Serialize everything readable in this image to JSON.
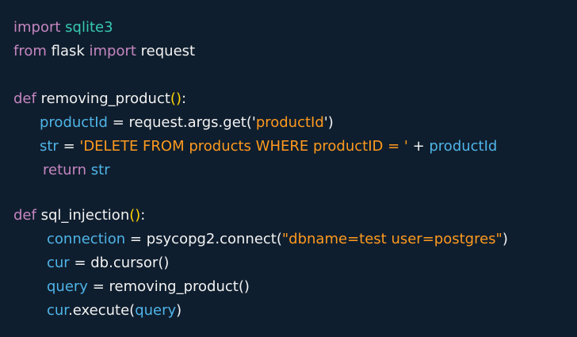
{
  "colors": {
    "background": "#0f1e2e",
    "keyword": "#c586c0",
    "module": "#36c9b3",
    "variable": "#4fb4e8",
    "string": "#ff9a1e",
    "paren": "#ffd400",
    "text": "#f2f2f2"
  },
  "lines": [
    [
      {
        "t": "import",
        "c": "kw"
      },
      {
        "t": " ",
        "c": "plain"
      },
      {
        "t": "sqlite3",
        "c": "mod"
      }
    ],
    [
      {
        "t": "from",
        "c": "kw"
      },
      {
        "t": " flask ",
        "c": "plain"
      },
      {
        "t": "import",
        "c": "kw"
      },
      {
        "t": " request",
        "c": "plain"
      }
    ],
    [],
    [
      {
        "t": "def",
        "c": "kw"
      },
      {
        "t": " removing_product",
        "c": "plain"
      },
      {
        "t": "()",
        "c": "paren"
      },
      {
        "t": ":",
        "c": "plain"
      }
    ],
    [
      {
        "t": "productId",
        "c": "var"
      },
      {
        "t": " = request.args.get('",
        "c": "plain"
      },
      {
        "t": "productId",
        "c": "str"
      },
      {
        "t": "')",
        "c": "plain"
      }
    ],
    [
      {
        "t": "str",
        "c": "var"
      },
      {
        "t": " = ",
        "c": "plain"
      },
      {
        "t": "'DELETE FROM products WHERE productID = '",
        "c": "str"
      },
      {
        "t": " + ",
        "c": "plain"
      },
      {
        "t": "productId",
        "c": "var"
      }
    ],
    [
      {
        "t": "return",
        "c": "kw"
      },
      {
        "t": " ",
        "c": "plain"
      },
      {
        "t": "str",
        "c": "var"
      }
    ],
    [],
    [
      {
        "t": "def",
        "c": "kw"
      },
      {
        "t": " sql_injection",
        "c": "plain"
      },
      {
        "t": "()",
        "c": "paren"
      },
      {
        "t": ":",
        "c": "plain"
      }
    ],
    [
      {
        "t": "connection",
        "c": "var"
      },
      {
        "t": " = psycopg2.connect(",
        "c": "plain"
      },
      {
        "t": "\"dbname=test user=postgres\"",
        "c": "str"
      },
      {
        "t": ")",
        "c": "plain"
      }
    ],
    [
      {
        "t": "cur",
        "c": "var"
      },
      {
        "t": " = db.cursor()",
        "c": "plain"
      }
    ],
    [
      {
        "t": "query",
        "c": "var"
      },
      {
        "t": " = removing_product()",
        "c": "plain"
      }
    ],
    [
      {
        "t": "cur",
        "c": "var"
      },
      {
        "t": ".execute(",
        "c": "plain"
      },
      {
        "t": "query",
        "c": "var"
      },
      {
        "t": ")",
        "c": "plain"
      }
    ]
  ]
}
